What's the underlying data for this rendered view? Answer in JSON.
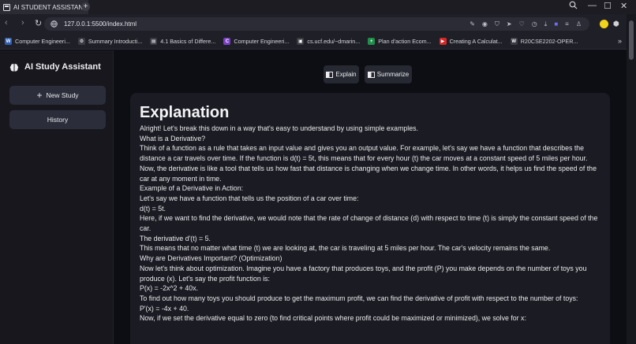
{
  "browser": {
    "tab_title": "AI STUDENT ASSISTANT",
    "url": "127.0.0.1:5500/index.html",
    "bookmarks": [
      {
        "label": "Computer Engineeri...",
        "icon": "W",
        "color": "#2f5fb3"
      },
      {
        "label": "Summary Introducti...",
        "icon": "gear",
        "color": "#3a3b44"
      },
      {
        "label": "4.1 Basics of Differe...",
        "icon": "doc",
        "color": "#3a3b44"
      },
      {
        "label": "Computer Engineeri...",
        "icon": "C",
        "color": "#7b3fc4"
      },
      {
        "label": "cs.ucf.edu/~dmarin...",
        "icon": "cs",
        "color": "#3a3b44"
      },
      {
        "label": "Plan d'action Ecom...",
        "icon": "+",
        "color": "#1f8f4a"
      },
      {
        "label": "Creating A Calculat...",
        "icon": "yt",
        "color": "#d62828"
      },
      {
        "label": "R20CSE2202-OPER...",
        "icon": "wp",
        "color": "#3a3b44"
      }
    ],
    "more_label": "»"
  },
  "sidebar": {
    "title": "AI Study Assistant",
    "new_study_label": "New Study",
    "history_label": "History"
  },
  "toolbar": {
    "explain_label": "Explain",
    "summarize_label": "Summarize"
  },
  "content": {
    "heading": "Explanation",
    "lines": [
      "Alright! Let's break this down in a way that's easy to understand by using simple examples.",
      "What is a Derivative?",
      "Think of a function as a rule that takes an input value and gives you an output value. For example, let's say we have a function that describes the distance a car travels over time. If the function is d(t) = 5t, this means that for every hour (t) the car moves at a constant speed of 5 miles per hour.",
      "Now, the derivative is like a tool that tells us how fast that distance is changing when we change time. In other words, it helps us find the speed of the car at any moment in time.",
      "Example of a Derivative in Action:",
      "Let's say we have a function that tells us the position of a car over time:",
      "d(t) = 5t.",
      "Here, if we want to find the derivative, we would note that the rate of change of distance (d) with respect to time (t) is simply the constant speed of the car.",
      "The derivative d'(t) = 5.",
      "This means that no matter what time (t) we are looking at, the car is traveling at 5 miles per hour. The car's velocity remains the same.",
      "Why are Derivatives Important? (Optimization)",
      "Now let's think about optimization. Imagine you have a factory that produces toys, and the profit (P) you make depends on the number of toys you produce (x). Let's say the profit function is:",
      "P(x) = -2x^2 + 40x.",
      "To find out how many toys you should produce to get the maximum profit, we can find the derivative of profit with respect to the number of toys:",
      "P'(x) = -4x + 40.",
      "Now, if we set the derivative equal to zero (to find critical points where profit could be maximized or minimized), we solve for x:"
    ]
  },
  "colors": {
    "accent_profile": "#f2d21b",
    "sidebar_button_bg": "#2b2e3a"
  }
}
